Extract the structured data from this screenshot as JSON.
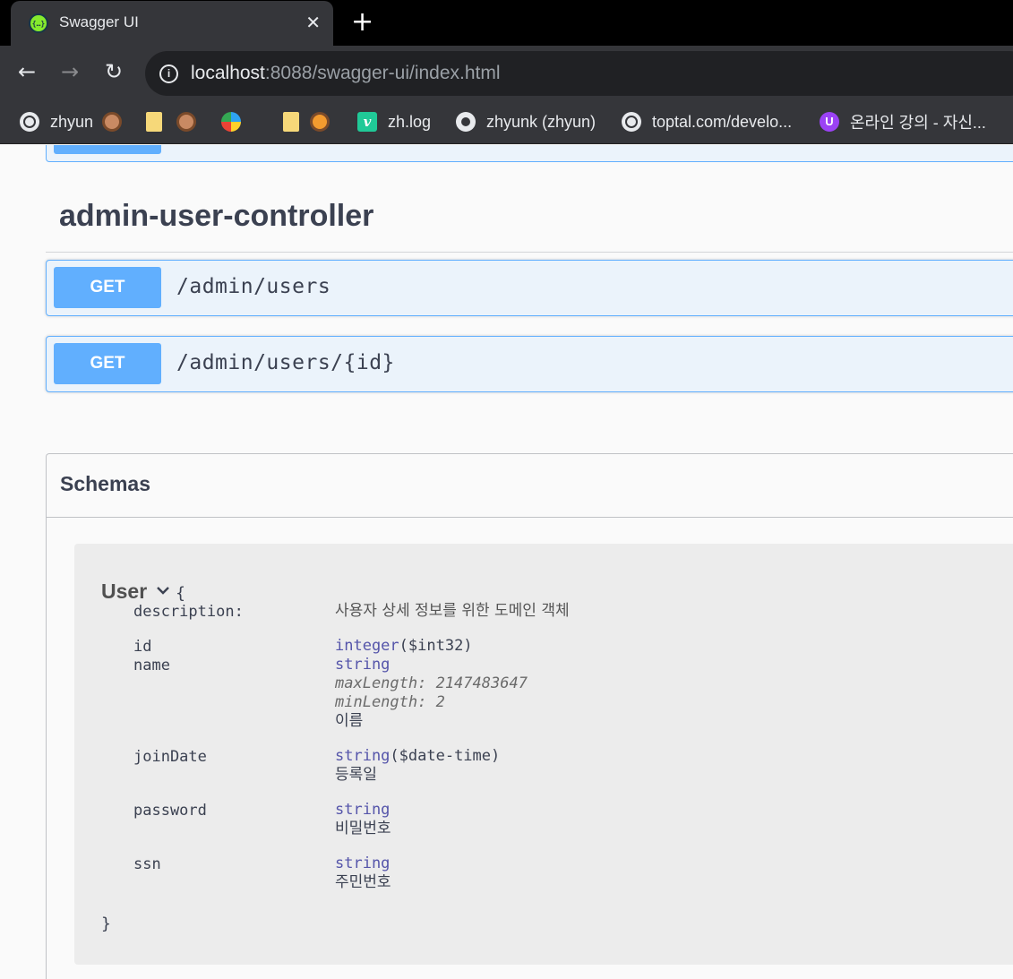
{
  "browser": {
    "tab_title": "Swagger UI",
    "tab_close": "✕",
    "new_tab": "+",
    "url_host": "localhost",
    "url_rest": ":8088/swagger-ui/index.html",
    "nav": {
      "back": "←",
      "forward": "→",
      "reload": "↻"
    },
    "info_icon": "i",
    "bookmarks": [
      {
        "label": "zhyun",
        "icon": "globe-icon"
      },
      {
        "label": "",
        "icon": "folder-icon"
      },
      {
        "label": "",
        "icon": "bird-icon"
      },
      {
        "label": "",
        "icon": "folder-icon"
      },
      {
        "label": "zh.log",
        "icon": "velog-icon"
      },
      {
        "label": "zhyunk (zhyun)",
        "icon": "github-icon"
      },
      {
        "label": "toptal.com/develo...",
        "icon": "globe-icon"
      },
      {
        "label": "온라인 강의 - 자신...",
        "icon": "inflearn-icon"
      }
    ],
    "velog_glyph": "v",
    "inflearn_glyph": "U"
  },
  "swagger": {
    "tag_title": "admin-user-controller",
    "operations": [
      {
        "method": "GET",
        "path": "/admin/users"
      },
      {
        "method": "GET",
        "path": "/admin/users/{id}"
      }
    ],
    "schemas_title": "Schemas",
    "model": {
      "name": "User",
      "open_brace": "{",
      "close_brace": "}",
      "description_label": "description:",
      "description": "사용자 상세 정보를 위한 도메인 객체",
      "properties": [
        {
          "name": "id",
          "type": "integer",
          "format": "($int32)",
          "constraints": [],
          "description": ""
        },
        {
          "name": "name",
          "type": "string",
          "format": "",
          "constraints": [
            "maxLength: 2147483647",
            "minLength: 2"
          ],
          "description": "이름"
        },
        {
          "name": "joinDate",
          "type": "string",
          "format": "($date-time)",
          "constraints": [],
          "description": "등록일"
        },
        {
          "name": "password",
          "type": "string",
          "format": "",
          "constraints": [],
          "description": "비밀번호"
        },
        {
          "name": "ssn",
          "type": "string",
          "format": "",
          "constraints": [],
          "description": "주민번호"
        }
      ]
    }
  },
  "colors": {
    "get_accent": "#61affe",
    "get_bg": "#ebf3fb",
    "type_color": "#55a"
  }
}
